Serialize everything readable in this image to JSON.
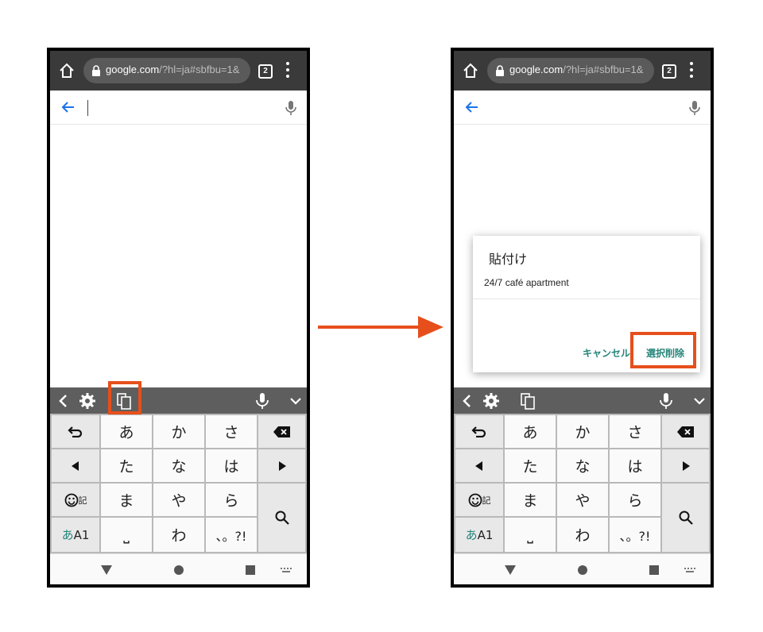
{
  "colors": {
    "accent": "#e64f1c",
    "dialog_button": "#26857a",
    "toolbar": "#5e5e5e",
    "browser_bar": "#3a3a3a"
  },
  "browser": {
    "url_host": "google.com",
    "url_path": "/?hl=ja#sbfbu=1&",
    "tab_count": "2"
  },
  "keyboard": {
    "rows": [
      [
        "⮌",
        "あ",
        "か",
        "さ",
        "⌫"
      ],
      [
        "◀",
        "た",
        "な",
        "は",
        "▶"
      ],
      [
        "☺記",
        "ま",
        "や",
        "ら",
        "🔍"
      ],
      [
        "あA1",
        "␣",
        "わ",
        "、。?!"
      ]
    ],
    "emoji_label": "記",
    "mode_kana": "あ",
    "mode_alpha": "A1",
    "space_symbol": "⎵",
    "punct": "、。?!"
  },
  "dialog": {
    "title": "貼付け",
    "clip_item": "24/7 café apartment",
    "cancel_label": "キャンセル",
    "clear_label": "選択削除"
  }
}
